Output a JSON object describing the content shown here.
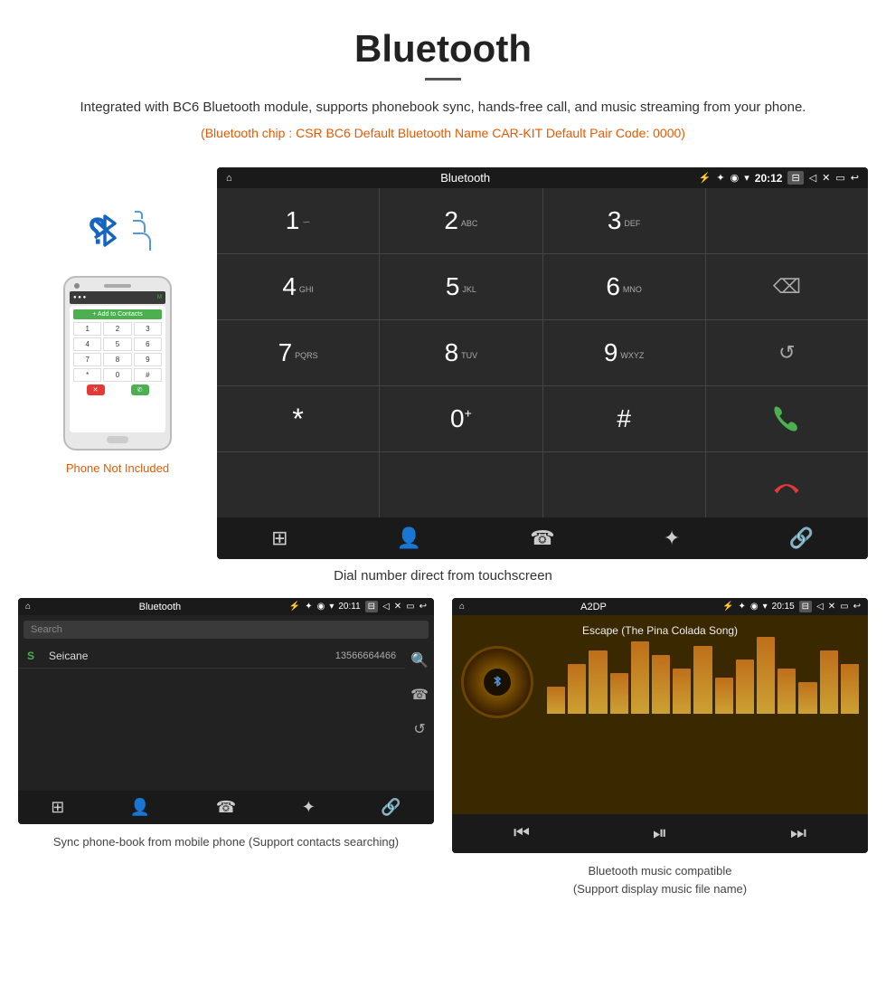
{
  "header": {
    "title": "Bluetooth",
    "description": "Integrated with BC6 Bluetooth module, supports phonebook sync, hands-free call, and music streaming from your phone.",
    "specs": "(Bluetooth chip : CSR BC6    Default Bluetooth Name CAR-KIT    Default Pair Code: 0000)"
  },
  "dial_screen": {
    "status_bar": {
      "home_icon": "⌂",
      "title": "Bluetooth",
      "usb_icon": "⚡",
      "bt_icon": "✦",
      "location_icon": "◉",
      "wifi_icon": "▾",
      "time": "20:12",
      "camera_icon": "⊟",
      "volume_icon": "◁",
      "close_icon": "✕",
      "window_icon": "▭",
      "back_icon": "↩"
    },
    "dial_pad": {
      "keys": [
        {
          "main": "1",
          "sub": "∽"
        },
        {
          "main": "2",
          "sub": "ABC"
        },
        {
          "main": "3",
          "sub": "DEF"
        },
        {
          "main": "",
          "sub": ""
        },
        {
          "main": "4",
          "sub": "GHI"
        },
        {
          "main": "5",
          "sub": "JKL"
        },
        {
          "main": "6",
          "sub": "MNO"
        },
        {
          "main": "⌫",
          "sub": ""
        },
        {
          "main": "7",
          "sub": "PQRS"
        },
        {
          "main": "8",
          "sub": "TUV"
        },
        {
          "main": "9",
          "sub": "WXYZ"
        },
        {
          "main": "↺",
          "sub": ""
        },
        {
          "main": "*",
          "sub": ""
        },
        {
          "main": "0+",
          "sub": ""
        },
        {
          "main": "#",
          "sub": ""
        },
        {
          "main": "☎",
          "sub": "",
          "green": true
        },
        {
          "main": "☎",
          "sub": "",
          "red": true
        }
      ],
      "nav_icons": [
        "⊞",
        "👤",
        "☎",
        "✦",
        "🔗"
      ]
    }
  },
  "caption_main": "Dial number direct from touchscreen",
  "phonebook_panel": {
    "status_bar": {
      "title": "Bluetooth",
      "time": "20:11"
    },
    "search_placeholder": "Search",
    "contacts": [
      {
        "letter": "S",
        "name": "Seicane",
        "phone": "13566664466"
      }
    ],
    "side_icons": [
      "🔍",
      "☎",
      "↺"
    ],
    "nav_icons": [
      "⊞",
      "👤",
      "☎",
      "✦",
      "🔗"
    ],
    "active_nav": 1,
    "caption": "Sync phone-book from mobile phone\n(Support contacts searching)"
  },
  "music_panel": {
    "status_bar": {
      "title": "A2DP",
      "time": "20:15"
    },
    "song_title": "Escape (The Pina Colada Song)",
    "eq_bars": [
      30,
      55,
      70,
      45,
      80,
      65,
      50,
      75,
      40,
      60,
      85,
      50,
      35,
      70,
      55
    ],
    "ctrl_icons": [
      "⏮",
      "⏯",
      "⏭"
    ],
    "caption": "Bluetooth music compatible\n(Support display music file name)"
  },
  "phone_not_included": "Phone Not Included"
}
